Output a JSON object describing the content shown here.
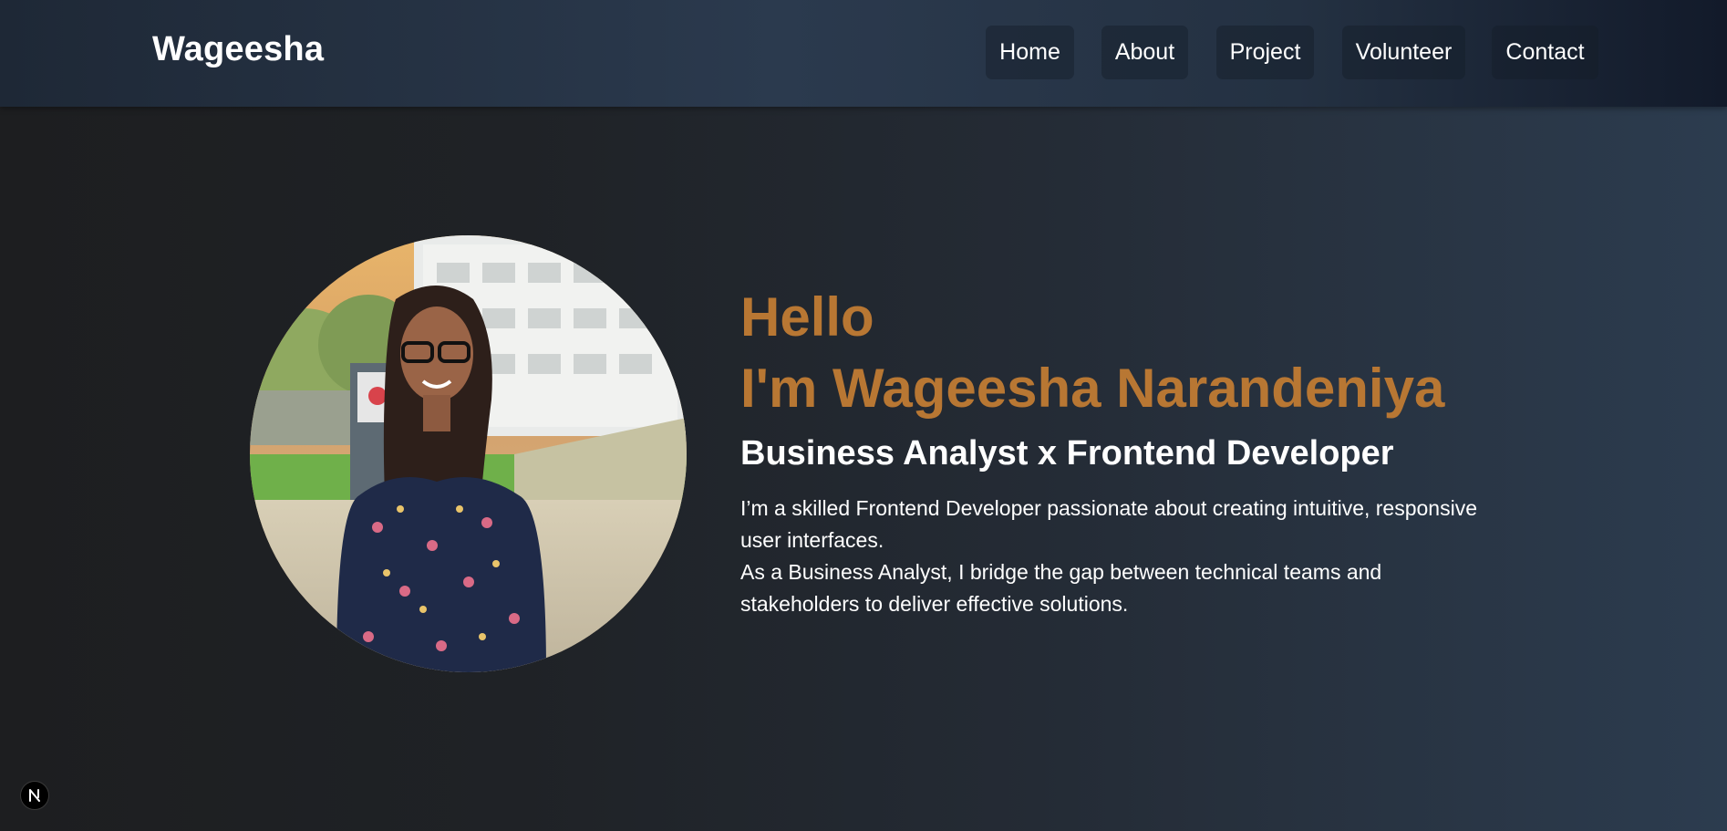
{
  "header": {
    "brand": "Wageesha",
    "nav": [
      {
        "label": "Home"
      },
      {
        "label": "About"
      },
      {
        "label": "Project"
      },
      {
        "label": "Volunteer"
      },
      {
        "label": "Contact"
      }
    ]
  },
  "hero": {
    "greeting": "Hello",
    "name_line": "I'm Wageesha Narandeniya",
    "role": "Business Analyst x Frontend Developer",
    "bio": [
      "I’m a skilled Frontend Developer passionate about creating intuitive, responsive user interfaces.",
      "As a Business Analyst, I bridge the gap between technical teams and stakeholders to deliver effective solutions."
    ]
  },
  "dev_badge": {
    "letter": "N"
  },
  "colors": {
    "accent": "#b87733",
    "header_bg": "#2b3a4e",
    "page_bg": "#1d1e20"
  }
}
